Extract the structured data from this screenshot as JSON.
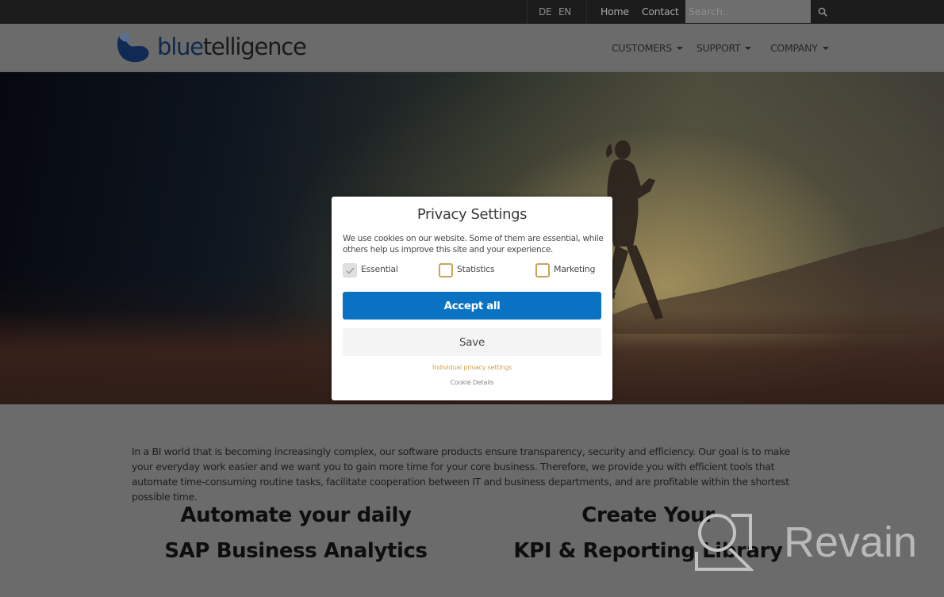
{
  "topbar": {
    "languages": [
      "DE",
      "EN"
    ],
    "links": [
      "Home",
      "Contact"
    ],
    "search": {
      "placeholder": "Search..",
      "value": ""
    }
  },
  "header": {
    "logo": {
      "part1": "blue",
      "part2": "telligence"
    },
    "nav": [
      {
        "label": "CUSTOMERS"
      },
      {
        "label": "SUPPORT"
      },
      {
        "label": "COMPANY"
      }
    ]
  },
  "modal": {
    "title": "Privacy Settings",
    "description": "We use cookies on our website. Some of them are essential, while others help us improve this site and your experience.",
    "checkboxes": [
      {
        "label": "Essential",
        "checked": true,
        "disabled": true
      },
      {
        "label": "Statistics",
        "checked": false
      },
      {
        "label": "Marketing",
        "checked": false
      }
    ],
    "accept_label": "Accept all",
    "save_label": "Save",
    "individual_link": "Individual privacy settings",
    "cookie_details_link": "Cookie Details",
    "colors": {
      "accent": "#0a72c2",
      "link": "#d4a24a",
      "checkbox_border": "#c9a45a"
    }
  },
  "content": {
    "intro": "In a BI world that is becoming increasingly complex, our software products ensure transparency, security and efficiency. Our goal is to make your everyday work easier and we want you to gain more time for your core business. Therefore, we provide you with efficient tools that automate time-consuming routine tasks, facilitate cooperation between IT and business departments, and are profitable within the shortest possible time.",
    "features": [
      {
        "line1": "Automate your daily",
        "line2": "SAP Business Analytics"
      },
      {
        "line1": "Create Your",
        "line2": "KPI & Reporting Library"
      }
    ]
  },
  "watermark": {
    "text": "Revain"
  }
}
